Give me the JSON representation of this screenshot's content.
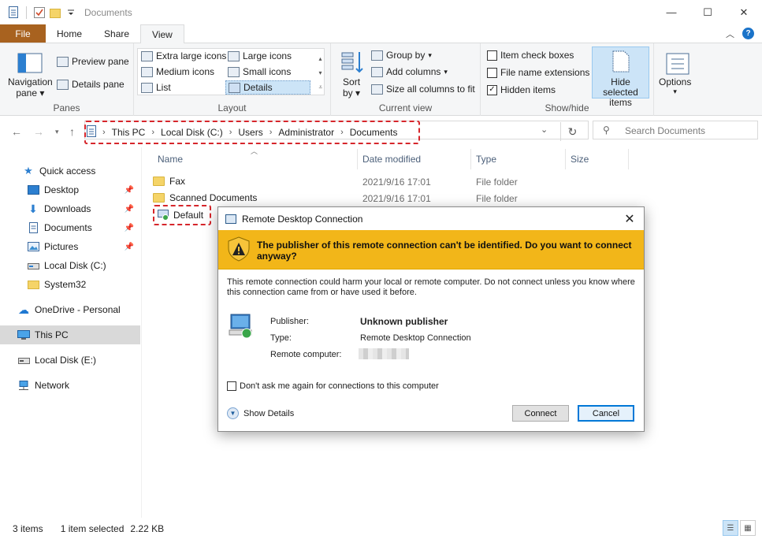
{
  "window": {
    "title": "Documents"
  },
  "tabs": {
    "file": "File",
    "home": "Home",
    "share": "Share",
    "view": "View"
  },
  "ribbon": {
    "panes": {
      "label": "Panes",
      "navigation_pane": "Navigation",
      "navigation_pane_2": "pane",
      "preview_pane": "Preview pane",
      "details_pane": "Details pane"
    },
    "layout": {
      "label": "Layout",
      "extra_large_icons": "Extra large icons",
      "large_icons": "Large icons",
      "medium_icons": "Medium icons",
      "small_icons": "Small icons",
      "list": "List",
      "details": "Details"
    },
    "current_view": {
      "label": "Current view",
      "sort_by": "Sort",
      "sort_by_2": "by",
      "group_by": "Group by",
      "add_columns": "Add columns",
      "size_all_columns": "Size all columns to fit"
    },
    "show_hide": {
      "label": "Show/hide",
      "item_check_boxes": "Item check boxes",
      "file_name_extensions": "File name extensions",
      "hidden_items": "Hidden items",
      "hide_selected": "Hide selected",
      "hide_selected_2": "items",
      "options": "Options"
    }
  },
  "address": {
    "crumbs": [
      "This PC",
      "Local Disk (C:)",
      "Users",
      "Administrator",
      "Documents"
    ],
    "search_placeholder": "Search Documents"
  },
  "sidebar": {
    "items": [
      {
        "label": "Quick access",
        "icon": "star-icon"
      },
      {
        "label": "Desktop",
        "icon": "desktop-icon"
      },
      {
        "label": "Downloads",
        "icon": "download-icon"
      },
      {
        "label": "Documents",
        "icon": "document-icon"
      },
      {
        "label": "Pictures",
        "icon": "pictures-icon"
      },
      {
        "label": "Local Disk (C:)",
        "icon": "drive-icon"
      },
      {
        "label": "System32",
        "icon": "folder-icon"
      },
      {
        "label": "OneDrive - Personal",
        "icon": "cloud-icon"
      },
      {
        "label": "This PC",
        "icon": "computer-icon"
      },
      {
        "label": "Local Disk (E:)",
        "icon": "drive-icon"
      },
      {
        "label": "Network",
        "icon": "network-icon"
      }
    ]
  },
  "filelist": {
    "columns": [
      "Name",
      "Date modified",
      "Type",
      "Size"
    ],
    "rows": [
      {
        "name": "Fax",
        "date": "2021/9/16 17:01",
        "type": "File folder"
      },
      {
        "name": "Scanned Documents",
        "date": "2021/9/16 17:01",
        "type": "File folder"
      },
      {
        "name": "Default"
      }
    ]
  },
  "status": {
    "count": "3 items",
    "selected": "1 item selected",
    "size": "2.22 KB"
  },
  "dialog": {
    "title": "Remote Desktop Connection",
    "banner": "The publisher of this remote connection can't be identified. Do you want to connect anyway?",
    "warning": "This remote connection could harm your local or remote computer. Do not connect unless you know where this connection came from or have used it before.",
    "publisher_label": "Publisher:",
    "publisher_value": "Unknown publisher",
    "type_label": "Type:",
    "type_value": "Remote Desktop Connection",
    "remote_label": "Remote computer:",
    "dont_ask": "Don't ask me again for connections to this computer",
    "show_details": "Show Details",
    "connect": "Connect",
    "cancel": "Cancel"
  },
  "colors": {
    "file_tab": "#a8621f",
    "banner": "#f2b619",
    "highlight": "#d6262b",
    "selection": "#cce4f7"
  }
}
